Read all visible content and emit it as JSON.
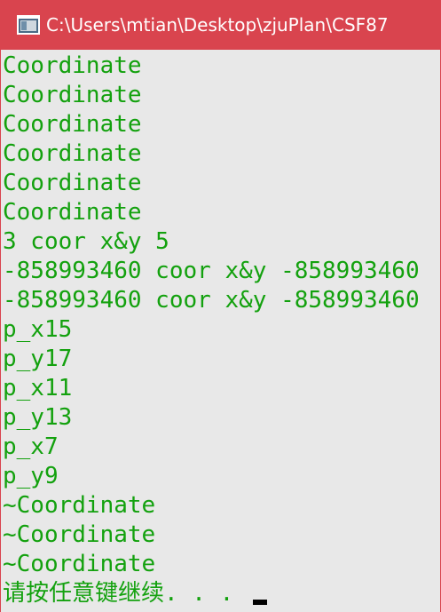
{
  "window": {
    "title": "C:\\Users\\mtian\\Desktop\\zjuPlan\\CSF87",
    "icon": "console-app-icon"
  },
  "console": {
    "lines": [
      "Coordinate",
      "Coordinate",
      "Coordinate",
      "Coordinate",
      "Coordinate",
      "Coordinate",
      "3 coor x&y 5",
      "-858993460 coor x&y -858993460",
      "-858993460 coor x&y -858993460",
      "p_x15",
      "p_y17",
      "p_x11",
      "p_y13",
      "p_x7",
      "p_y9",
      "~Coordinate",
      "~Coordinate",
      "~Coordinate"
    ],
    "prompt": "请按任意键继续. . ."
  },
  "colors": {
    "titlebar": "#d9444e",
    "text": "#13a10e",
    "background": "#e8e8e8"
  }
}
